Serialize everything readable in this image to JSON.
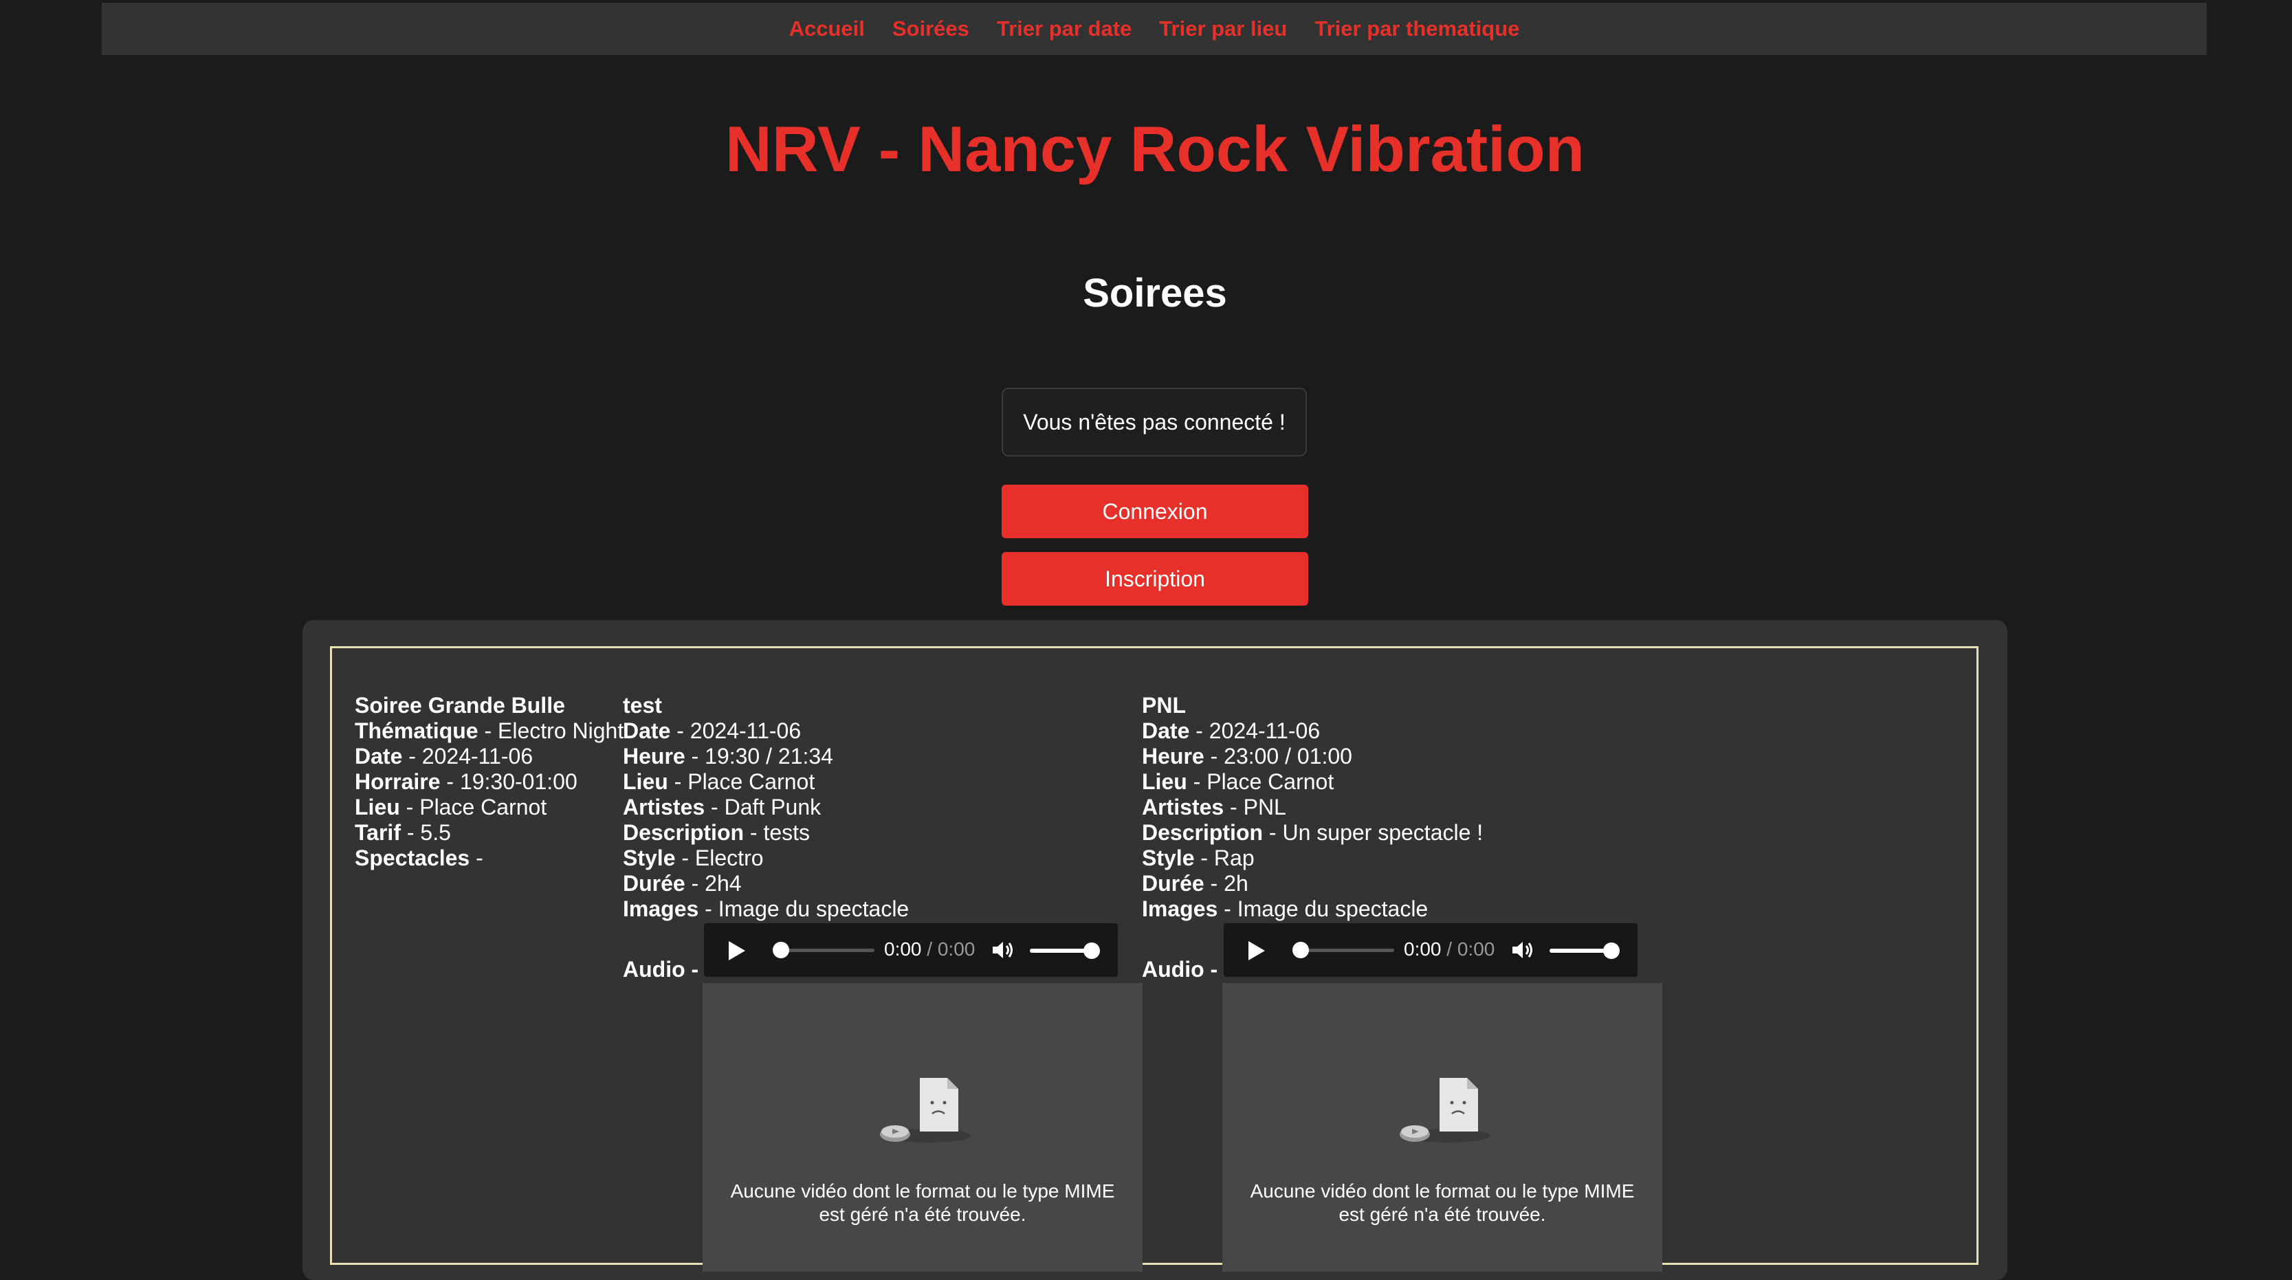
{
  "nav": {
    "items": [
      "Accueil",
      "Soirées",
      "Trier par date",
      "Trier par lieu",
      "Trier par thematique"
    ]
  },
  "site_title": "NRV - Nancy Rock Vibration",
  "section_title": "Soirees",
  "status_message": "Vous n'êtes pas connecté !",
  "buttons": {
    "login": "Connexion",
    "register": "Inscription"
  },
  "soiree": {
    "name": "Soiree Grande Bulle",
    "fields": [
      {
        "label": "Thématique",
        "value": " - Electro Night"
      },
      {
        "label": "Date",
        "value": " - 2024-11-06"
      },
      {
        "label": "Horraire",
        "value": " - 19:30-01:00"
      },
      {
        "label": "Lieu",
        "value": " - Place Carnot"
      },
      {
        "label": "Tarif",
        "value": " - 5.5"
      },
      {
        "label": "Spectacles",
        "value": " -"
      }
    ]
  },
  "spectacles": [
    {
      "name": "test",
      "fields": [
        {
          "label": "Date",
          "value": " - 2024-11-06"
        },
        {
          "label": "Heure",
          "value": " - 19:30 / 21:34"
        },
        {
          "label": "Lieu",
          "value": " - Place Carnot"
        },
        {
          "label": "Artistes",
          "value": " - Daft Punk"
        },
        {
          "label": "Description",
          "value": " - tests"
        },
        {
          "label": "Style",
          "value": " - Electro"
        },
        {
          "label": "Durée",
          "value": " - 2h4"
        },
        {
          "label": "Images",
          "value": " - Image du spectacle"
        }
      ],
      "audio_label": "Audio -",
      "audio_time_current": "0:00",
      "audio_time_total": " / 0:00",
      "video_message_1": "Aucune vidéo dont le format ou le type MIME",
      "video_message_2": "est géré n'a été trouvée."
    },
    {
      "name": "PNL",
      "fields": [
        {
          "label": "Date",
          "value": " - 2024-11-06"
        },
        {
          "label": "Heure",
          "value": " - 23:00 / 01:00"
        },
        {
          "label": "Lieu",
          "value": " - Place Carnot"
        },
        {
          "label": "Artistes",
          "value": " - PNL"
        },
        {
          "label": "Description",
          "value": " - Un super spectacle !"
        },
        {
          "label": "Style",
          "value": " - Rap"
        },
        {
          "label": "Durée",
          "value": " - 2h"
        },
        {
          "label": "Images",
          "value": " - Image du spectacle"
        }
      ],
      "audio_label": "Audio -",
      "audio_time_current": "0:00",
      "audio_time_total": " / 0:00",
      "video_message_1": "Aucune vidéo dont le format ou le type MIME",
      "video_message_2": "est géré n'a été trouvée."
    }
  ],
  "colors": {
    "accent": "#e8302a",
    "background": "#1b1b1b",
    "panel": "#333333",
    "card_border": "#e9dfb3"
  }
}
